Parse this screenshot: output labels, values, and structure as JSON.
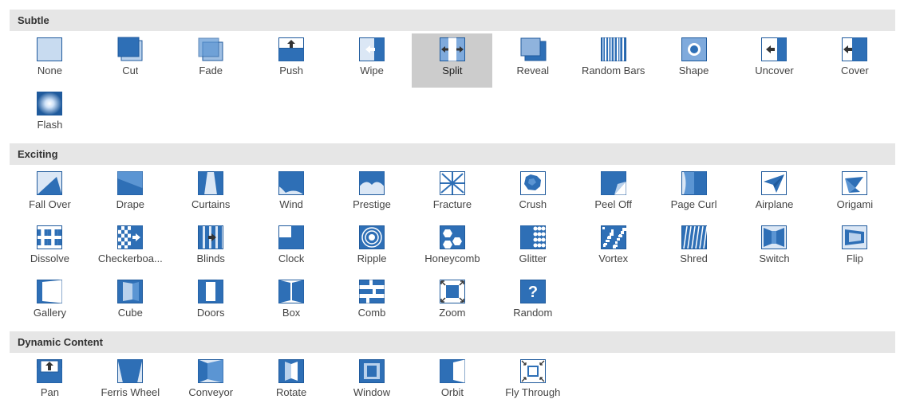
{
  "sections": [
    {
      "title": "Subtle",
      "items": [
        {
          "label": "None",
          "icon": "none-icon"
        },
        {
          "label": "Cut",
          "icon": "cut-icon"
        },
        {
          "label": "Fade",
          "icon": "fade-icon"
        },
        {
          "label": "Push",
          "icon": "push-icon"
        },
        {
          "label": "Wipe",
          "icon": "wipe-icon"
        },
        {
          "label": "Split",
          "icon": "split-icon",
          "selected": true
        },
        {
          "label": "Reveal",
          "icon": "reveal-icon"
        },
        {
          "label": "Random Bars",
          "icon": "random-bars-icon"
        },
        {
          "label": "Shape",
          "icon": "shape-icon"
        },
        {
          "label": "Uncover",
          "icon": "uncover-icon"
        },
        {
          "label": "Cover",
          "icon": "cover-icon"
        },
        {
          "label": "Flash",
          "icon": "flash-icon"
        }
      ]
    },
    {
      "title": "Exciting",
      "items": [
        {
          "label": "Fall Over",
          "icon": "fall-over-icon"
        },
        {
          "label": "Drape",
          "icon": "drape-icon"
        },
        {
          "label": "Curtains",
          "icon": "curtains-icon"
        },
        {
          "label": "Wind",
          "icon": "wind-icon"
        },
        {
          "label": "Prestige",
          "icon": "prestige-icon"
        },
        {
          "label": "Fracture",
          "icon": "fracture-icon"
        },
        {
          "label": "Crush",
          "icon": "crush-icon"
        },
        {
          "label": "Peel Off",
          "icon": "peel-off-icon"
        },
        {
          "label": "Page Curl",
          "icon": "page-curl-icon"
        },
        {
          "label": "Airplane",
          "icon": "airplane-icon"
        },
        {
          "label": "Origami",
          "icon": "origami-icon"
        },
        {
          "label": "Dissolve",
          "icon": "dissolve-icon"
        },
        {
          "label": "Checkerboa...",
          "icon": "checkerboard-icon"
        },
        {
          "label": "Blinds",
          "icon": "blinds-icon"
        },
        {
          "label": "Clock",
          "icon": "clock-icon"
        },
        {
          "label": "Ripple",
          "icon": "ripple-icon"
        },
        {
          "label": "Honeycomb",
          "icon": "honeycomb-icon"
        },
        {
          "label": "Glitter",
          "icon": "glitter-icon"
        },
        {
          "label": "Vortex",
          "icon": "vortex-icon"
        },
        {
          "label": "Shred",
          "icon": "shred-icon"
        },
        {
          "label": "Switch",
          "icon": "switch-icon"
        },
        {
          "label": "Flip",
          "icon": "flip-icon"
        },
        {
          "label": "Gallery",
          "icon": "gallery-icon"
        },
        {
          "label": "Cube",
          "icon": "cube-icon"
        },
        {
          "label": "Doors",
          "icon": "doors-icon"
        },
        {
          "label": "Box",
          "icon": "box-icon"
        },
        {
          "label": "Comb",
          "icon": "comb-icon"
        },
        {
          "label": "Zoom",
          "icon": "zoom-icon"
        },
        {
          "label": "Random",
          "icon": "random-icon",
          "glyph": "?"
        }
      ]
    },
    {
      "title": "Dynamic Content",
      "items": [
        {
          "label": "Pan",
          "icon": "pan-icon"
        },
        {
          "label": "Ferris Wheel",
          "icon": "ferris-wheel-icon"
        },
        {
          "label": "Conveyor",
          "icon": "conveyor-icon"
        },
        {
          "label": "Rotate",
          "icon": "rotate-icon"
        },
        {
          "label": "Window",
          "icon": "window-icon"
        },
        {
          "label": "Orbit",
          "icon": "orbit-icon"
        },
        {
          "label": "Fly Through",
          "icon": "fly-through-icon"
        }
      ]
    }
  ],
  "colors": {
    "primary": "#2e6fb6",
    "light": "#b9d1ec",
    "pale": "#dbe7f5",
    "section_bg": "#e6e6e6",
    "selected_bg": "#cccccc"
  }
}
